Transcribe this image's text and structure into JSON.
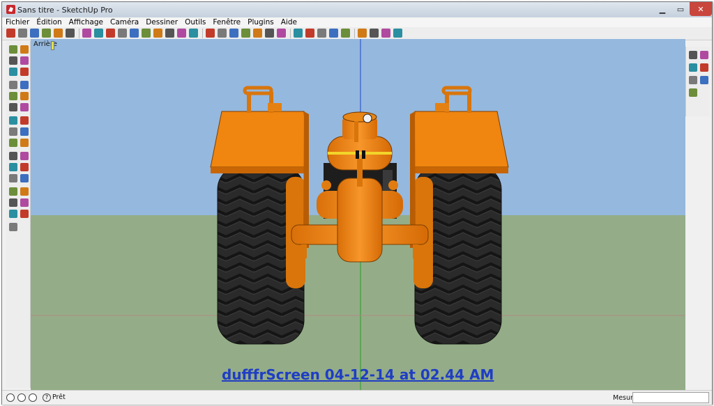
{
  "window": {
    "title": "Sans titre - SketchUp Pro"
  },
  "menu": [
    "Fichier",
    "Édition",
    "Affichage",
    "Caméra",
    "Dessiner",
    "Outils",
    "Fenêtre",
    "Plugins",
    "Aide"
  ],
  "scene": {
    "label": "Arrière"
  },
  "watermark": "dufffrScreen 04-12-14 at 02.44 AM",
  "status": {
    "text": "Prêt",
    "measure_label": "Mesures",
    "measure_value": ""
  },
  "colors": {
    "sky": "#95b8de",
    "ground": "#94ad88",
    "tractor_orange": "#f28a12",
    "tire": "#2b2b2b",
    "watermark": "#1f3dc5"
  },
  "icons": {
    "toolbar": [
      "select-icon",
      "eraser-icon",
      "pencil-icon",
      "rectangle-icon",
      "circle-icon",
      "arc-icon",
      "push-pull-icon",
      "move-icon",
      "rotate-icon",
      "offset-icon",
      "tape-measure-icon",
      "paint-bucket-icon",
      "orbit-icon",
      "pan-icon",
      "zoom-icon",
      "zoom-extents-icon",
      "components-icon",
      "iso-view-icon",
      "top-view-icon",
      "front-view-icon",
      "right-view-icon",
      "back-view-icon",
      "left-view-icon",
      "xray-icon",
      "wireframe-icon",
      "hidden-line-icon",
      "shaded-icon",
      "textured-icon",
      "sandbox-icon",
      "warehouse-icon",
      "layers-icon",
      "shadow-icon"
    ],
    "left": [
      "select-icon",
      "eraser-icon",
      "paint-bucket-icon",
      "rectangle-icon",
      "line-icon",
      "circle-icon",
      "arc-icon",
      "polygon-icon",
      "freehand-icon",
      "move-icon",
      "push-pull-icon",
      "rotate-icon",
      "follow-me-icon",
      "scale-icon",
      "offset-icon",
      "tape-measure-icon",
      "dimension-icon",
      "protractor-icon",
      "text-icon",
      "axes-icon",
      "3d-text-icon",
      "orbit-icon",
      "pan-icon",
      "zoom-icon",
      "zoom-window-icon",
      "zoom-extents-icon",
      "previous-icon",
      "position-camera-icon",
      "look-around-icon",
      "walk-icon",
      "section-plane-icon"
    ],
    "right": [
      "smoove-icon",
      "stamp-icon",
      "drape-icon",
      "add-detail-icon",
      "flip-edge-icon",
      "from-contours-icon",
      "from-scratch-icon"
    ]
  }
}
